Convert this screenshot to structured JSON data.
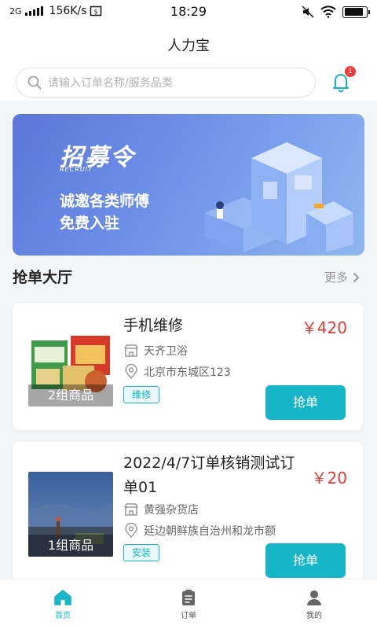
{
  "status_bar": {
    "network": "2G",
    "speed": "156K/s",
    "time": "18:29"
  },
  "header": {
    "title": "人力宝"
  },
  "search": {
    "placeholder": "请输入订单名称/服务品类"
  },
  "notifications": {
    "badge_count": "1"
  },
  "banner": {
    "logo_text": "招募令",
    "logo_sub": "RECRUIT",
    "line1": "诚邀各类师傅",
    "line2": "免费入驻"
  },
  "section": {
    "title": "抢单大厅",
    "more_label": "更多"
  },
  "orders": [
    {
      "title": "手机维修",
      "price": "￥420",
      "shop": "天齐卫浴",
      "address": "北京市东城区123",
      "tag": "维修",
      "goods_count": "2组商品",
      "button_label": "抢单"
    },
    {
      "title_line1": "2022/4/7订单核销测试订",
      "title_line2": "单01",
      "price": "￥20",
      "shop": "黄强杂货店",
      "address": "延边朝鲜族自治州和龙市额",
      "tag": "安装",
      "goods_count": "1组商品",
      "button_label": "抢单"
    }
  ],
  "tabbar": {
    "items": [
      {
        "label": "首页",
        "icon": "home-icon",
        "active": true
      },
      {
        "label": "订单",
        "icon": "order-icon",
        "active": false
      },
      {
        "label": "我的",
        "icon": "profile-icon",
        "active": false
      }
    ]
  },
  "colors": {
    "accent": "#16b6c8",
    "price": "#e23a3a",
    "badge": "#f03a3a"
  }
}
